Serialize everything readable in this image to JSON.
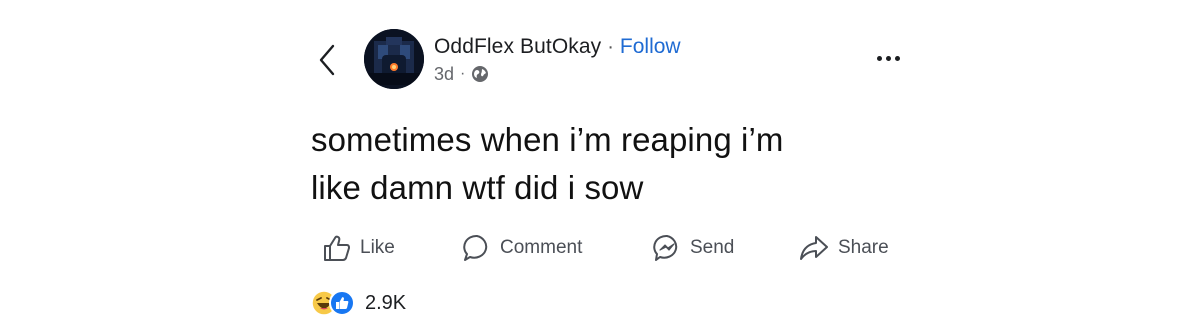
{
  "post": {
    "author_name": "OddFlex ButOkay",
    "separator": "·",
    "follow_label": "Follow",
    "timestamp": "3d",
    "meta_separator": "·",
    "visibility_icon": "globe-icon",
    "text_line1": "sometimes when i’m reaping i’m",
    "text_line2": "like damn wtf did i sow"
  },
  "actions": {
    "like_label": "Like",
    "comment_label": "Comment",
    "send_label": "Send",
    "share_label": "Share"
  },
  "reactions": {
    "icons": [
      "haha-icon",
      "like-icon"
    ],
    "count": "2.9K"
  },
  "colors": {
    "follow_link": "#1f6bd3",
    "like_reaction": "#1877f2",
    "haha_reaction": "#f7c948",
    "text_primary": "#1c1e21",
    "text_secondary": "#65676b"
  }
}
